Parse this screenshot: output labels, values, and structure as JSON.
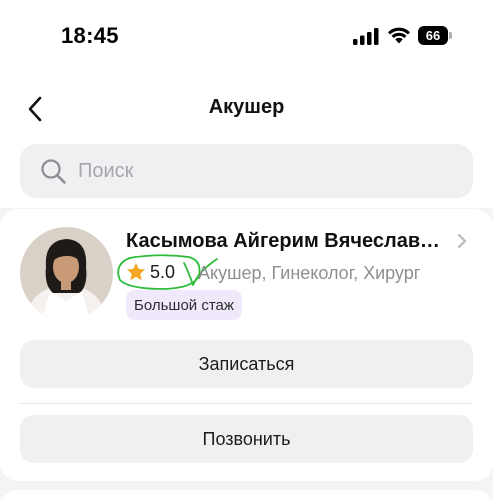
{
  "status_bar": {
    "time": "18:45",
    "battery": "66",
    "icons": [
      "signal-icon",
      "wifi-icon",
      "battery-icon"
    ]
  },
  "nav": {
    "back_icon": "chevron-left-icon",
    "title": "Акушер"
  },
  "search": {
    "placeholder": "Поиск",
    "value": "",
    "icon": "search-icon"
  },
  "doctor": {
    "name": "Касымова Айгерим Вячеславо...",
    "rating": "5.0",
    "specialties": "Акушер, Гинеколог, Хирург",
    "badge": "Большой стаж",
    "book_label": "Записаться",
    "call_label": "Позвонить",
    "star_color": "#f5a623",
    "annotation_color": "#2ebd3a",
    "badge_color": "#efe9fb"
  }
}
